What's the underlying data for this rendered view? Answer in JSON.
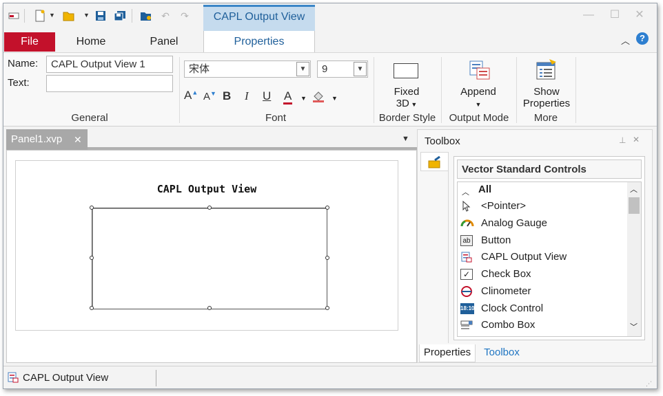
{
  "window": {
    "contextual_tab_group": "CAPL Output View",
    "colors": {
      "accent": "#3b86c7",
      "file_tab": "#c3112b",
      "contextual_header": "#c5dbee"
    }
  },
  "quick_access": {
    "icons": [
      "app-menu-icon",
      "new-file-icon",
      "open-folder-icon",
      "save-icon",
      "save-all-icon",
      "folder-settings-icon",
      "undo-icon",
      "redo-icon"
    ]
  },
  "tabs": {
    "file": "File",
    "home": "Home",
    "panel": "Panel",
    "properties": "Properties"
  },
  "ribbon": {
    "general": {
      "name_label": "Name:",
      "name_value": "CAPL Output View 1",
      "text_label": "Text:",
      "text_value": "",
      "group_label": "General"
    },
    "font": {
      "family": "宋体",
      "size": "9",
      "group_label": "Font",
      "buttons": {
        "grow": "A",
        "shrink": "A",
        "bold": "B",
        "italic": "I",
        "underline": "U",
        "color": "A"
      }
    },
    "border_style": {
      "button_line1": "Fixed",
      "button_line2": "3D",
      "group_label": "Border Style"
    },
    "output_mode": {
      "button_label": "Append",
      "group_label": "Output Mode"
    },
    "more": {
      "button_line1": "Show",
      "button_line2": "Properties",
      "group_label": "More"
    }
  },
  "document": {
    "tab_label": "Panel1.xvp",
    "control_title": "CAPL Output View"
  },
  "toolbox": {
    "title": "Toolbox",
    "section_title": "Vector Standard Controls",
    "category": "All",
    "items": [
      {
        "label": "<Pointer>",
        "icon": "pointer-icon"
      },
      {
        "label": "Analog Gauge",
        "icon": "analog-gauge-icon"
      },
      {
        "label": "Button",
        "icon": "button-control-icon"
      },
      {
        "label": "CAPL Output View",
        "icon": "capl-output-view-icon"
      },
      {
        "label": "Check Box",
        "icon": "check-box-icon"
      },
      {
        "label": "Clinometer",
        "icon": "clinometer-icon"
      },
      {
        "label": "Clock Control",
        "icon": "clock-control-icon"
      },
      {
        "label": "Combo Box",
        "icon": "combo-box-icon"
      }
    ],
    "bottom_tabs": {
      "properties": "Properties",
      "toolbox": "Toolbox"
    }
  },
  "statusbar": {
    "text": "CAPL Output View"
  }
}
